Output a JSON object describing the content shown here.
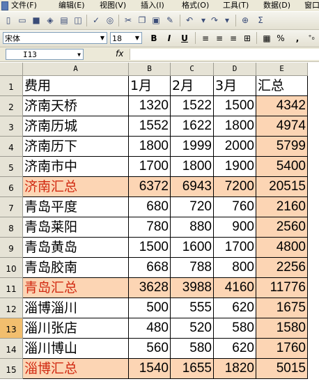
{
  "menu": {
    "items": [
      {
        "id": "file",
        "label": "文件(F)"
      },
      {
        "id": "edit",
        "label": "编辑(E)"
      },
      {
        "id": "view",
        "label": "视图(V)"
      },
      {
        "id": "insert",
        "label": "插入(I)"
      },
      {
        "id": "format",
        "label": "格式(O)"
      },
      {
        "id": "tools",
        "label": "工具(T)"
      },
      {
        "id": "data",
        "label": "数据(D)"
      },
      {
        "id": "window",
        "label": "窗口"
      }
    ]
  },
  "toolbar": {
    "icons": [
      "new-icon",
      "open-icon",
      "save-icon",
      "permission-icon",
      "print-icon",
      "print-preview-icon",
      "spelling-icon",
      "research-icon",
      "cut-icon",
      "copy-icon",
      "paste-icon",
      "format-painter-icon",
      "undo-icon",
      "redo-icon",
      "hyperlink-icon",
      "autosum-icon"
    ]
  },
  "format_toolbar": {
    "font_name": "宋体",
    "font_size": "18",
    "bold_label": "B",
    "italic_label": "I",
    "underline_label": "U",
    "percent_label": "%",
    "comma_label": ","
  },
  "formula_bar": {
    "name_box": "I13",
    "fx_label": "fx",
    "formula": ""
  },
  "columns": [
    "A",
    "B",
    "C",
    "D",
    "E"
  ],
  "rows": [
    {
      "n": "1",
      "cells": [
        "费用",
        "1月",
        "2月",
        "3月",
        "汇总"
      ],
      "subtotal": false
    },
    {
      "n": "2",
      "cells": [
        "济南天桥",
        "1320",
        "1522",
        "1500",
        "4342"
      ],
      "subtotal": false
    },
    {
      "n": "3",
      "cells": [
        "济南历城",
        "1552",
        "1622",
        "1800",
        "4974"
      ],
      "subtotal": false
    },
    {
      "n": "4",
      "cells": [
        "济南历下",
        "1800",
        "1999",
        "2000",
        "5799"
      ],
      "subtotal": false
    },
    {
      "n": "5",
      "cells": [
        "济南市中",
        "1700",
        "1800",
        "1900",
        "5400"
      ],
      "subtotal": false
    },
    {
      "n": "6",
      "cells": [
        "济南汇总",
        "6372",
        "6943",
        "7200",
        "20515"
      ],
      "subtotal": true
    },
    {
      "n": "7",
      "cells": [
        "青岛平度",
        "680",
        "720",
        "760",
        "2160"
      ],
      "subtotal": false
    },
    {
      "n": "8",
      "cells": [
        "青岛莱阳",
        "780",
        "880",
        "900",
        "2560"
      ],
      "subtotal": false
    },
    {
      "n": "9",
      "cells": [
        "青岛黄岛",
        "1500",
        "1600",
        "1700",
        "4800"
      ],
      "subtotal": false
    },
    {
      "n": "10",
      "cells": [
        "青岛胶南",
        "668",
        "788",
        "800",
        "2256"
      ],
      "subtotal": false
    },
    {
      "n": "11",
      "cells": [
        "青岛汇总",
        "3628",
        "3988",
        "4160",
        "11776"
      ],
      "subtotal": true
    },
    {
      "n": "12",
      "cells": [
        "淄博淄川",
        "500",
        "555",
        "620",
        "1675"
      ],
      "subtotal": false
    },
    {
      "n": "13",
      "cells": [
        "淄川张店",
        "480",
        "520",
        "580",
        "1580"
      ],
      "subtotal": false
    },
    {
      "n": "14",
      "cells": [
        "淄川博山",
        "560",
        "580",
        "620",
        "1760"
      ],
      "subtotal": false
    },
    {
      "n": "15",
      "cells": [
        "淄博汇总",
        "1540",
        "1655",
        "1820",
        "5015"
      ],
      "subtotal": true
    }
  ],
  "selected_row": "13",
  "colors": {
    "subtotal_fill": "#fcd5b4",
    "subtotal_text": "#d12a12",
    "total_column_fill": "#fcd5b4",
    "selected_row_header": "#f2be6e"
  }
}
